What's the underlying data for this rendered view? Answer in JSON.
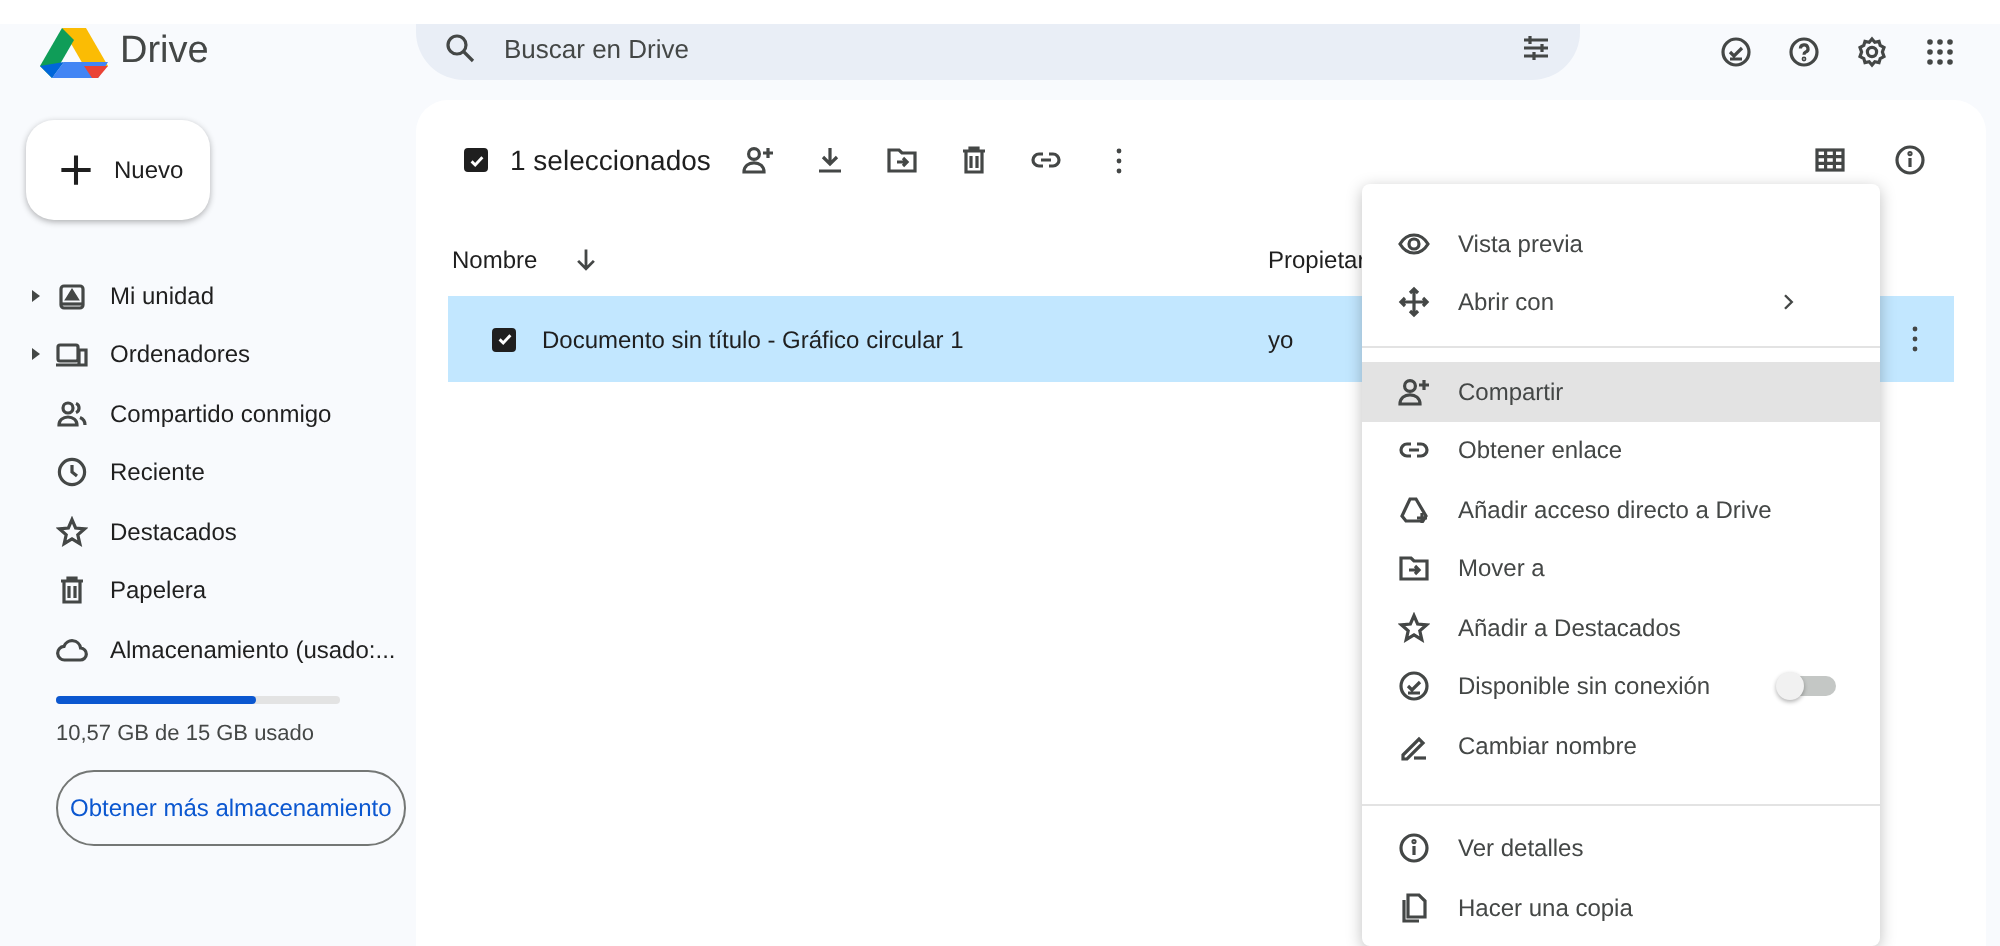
{
  "header": {
    "app_name": "Drive",
    "search": {
      "placeholder": "Buscar en Drive"
    }
  },
  "new_button": {
    "label": "Nuevo"
  },
  "sidebar": {
    "items": [
      {
        "label": "Mi unidad",
        "expandable": true
      },
      {
        "label": "Ordenadores",
        "expandable": true
      },
      {
        "label": "Compartido conmigo",
        "expandable": false
      },
      {
        "label": "Reciente",
        "expandable": false
      },
      {
        "label": "Destacados",
        "expandable": false
      },
      {
        "label": "Papelera",
        "expandable": false
      },
      {
        "label": "Almacenamiento (usado:...",
        "expandable": false
      }
    ]
  },
  "storage": {
    "level": 0.705,
    "text": "10,57 GB de 15 GB usado",
    "button": "Obtener más almacenamiento"
  },
  "selection_bar": {
    "checked": true,
    "text": "1 seleccionados"
  },
  "table": {
    "columns": [
      "Nombre",
      "Propietar"
    ],
    "rows": [
      {
        "selected": true,
        "checked": true,
        "name": "Documento sin título - Gráfico circular 1",
        "owner": "yo"
      }
    ]
  },
  "context_menu": {
    "sections": [
      {
        "items": [
          {
            "label": "Vista previa",
            "highlighted": false,
            "submenu": false
          },
          {
            "label": "Abrir con",
            "highlighted": false,
            "submenu": true
          }
        ]
      },
      {
        "items": [
          {
            "label": "Compartir",
            "highlighted": true,
            "submenu": false
          },
          {
            "label": "Obtener enlace",
            "highlighted": false,
            "submenu": false
          },
          {
            "label": "Añadir acceso directo a Drive",
            "highlighted": false,
            "submenu": false
          },
          {
            "label": "Mover a",
            "highlighted": false,
            "submenu": false
          },
          {
            "label": "Añadir a Destacados",
            "highlighted": false,
            "submenu": false
          },
          {
            "label": "Disponible sin conexión",
            "highlighted": false,
            "submenu": false,
            "toggle_on": false
          },
          {
            "label": "Cambiar nombre",
            "highlighted": false,
            "submenu": false
          }
        ]
      },
      {
        "items": [
          {
            "label": "Ver detalles",
            "highlighted": false,
            "submenu": false
          },
          {
            "label": "Hacer una copia",
            "highlighted": false,
            "submenu": false
          }
        ]
      }
    ]
  }
}
